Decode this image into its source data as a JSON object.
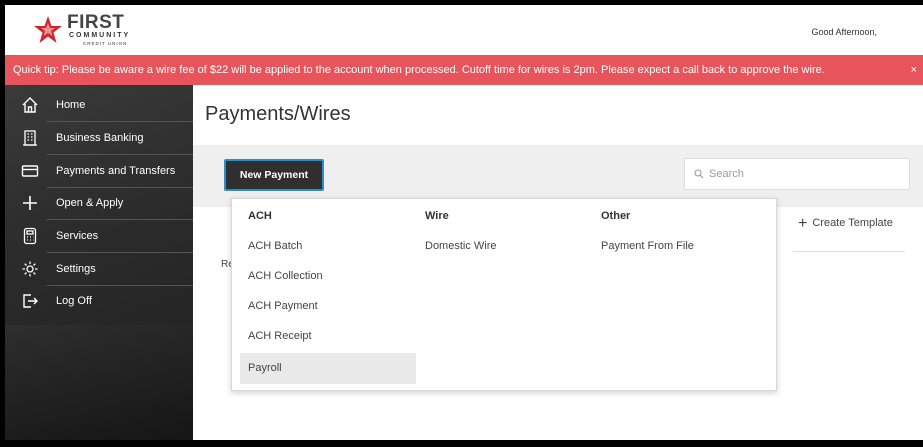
{
  "header": {
    "logo_text": "FIRST",
    "logo_sub": "COMMUNITY",
    "logo_sub2": "CREDIT UNION",
    "greeting": "Good Afternoon,"
  },
  "tipbar": {
    "text": "Quick tip: Please be aware a wire fee of $22 will be applied to the account when processed. Cutoff time for wires is 2pm. Please expect a call back to approve the wire.",
    "close": "×"
  },
  "sidebar": {
    "items": [
      {
        "label": "Home",
        "icon": "home-icon"
      },
      {
        "label": "Business Banking",
        "icon": "building-icon"
      },
      {
        "label": "Payments and Transfers",
        "icon": "card-icon"
      },
      {
        "label": "Open & Apply",
        "icon": "plus-icon"
      },
      {
        "label": "Services",
        "icon": "calculator-icon"
      },
      {
        "label": "Settings",
        "icon": "gear-icon"
      },
      {
        "label": "Log Off",
        "icon": "logout-icon"
      }
    ]
  },
  "main": {
    "title": "Payments/Wires",
    "new_payment_label": "New Payment",
    "search_placeholder": "Search",
    "create_template": "Create Template",
    "partial_text": "Re"
  },
  "dropdown": {
    "columns": [
      {
        "heading": "ACH",
        "options": [
          "ACH Batch",
          "ACH Collection",
          "ACH Payment",
          "ACH Receipt",
          "Payroll"
        ]
      },
      {
        "heading": "Wire",
        "options": [
          "Domestic Wire"
        ]
      },
      {
        "heading": "Other",
        "options": [
          "Payment From File"
        ]
      }
    ],
    "highlighted": "Payroll"
  },
  "colors": {
    "tip_bg": "#e8545b",
    "brand_red": "#d4242b",
    "sidebar_bg": "#2c2c2c",
    "button_border": "#2a8ec9"
  }
}
